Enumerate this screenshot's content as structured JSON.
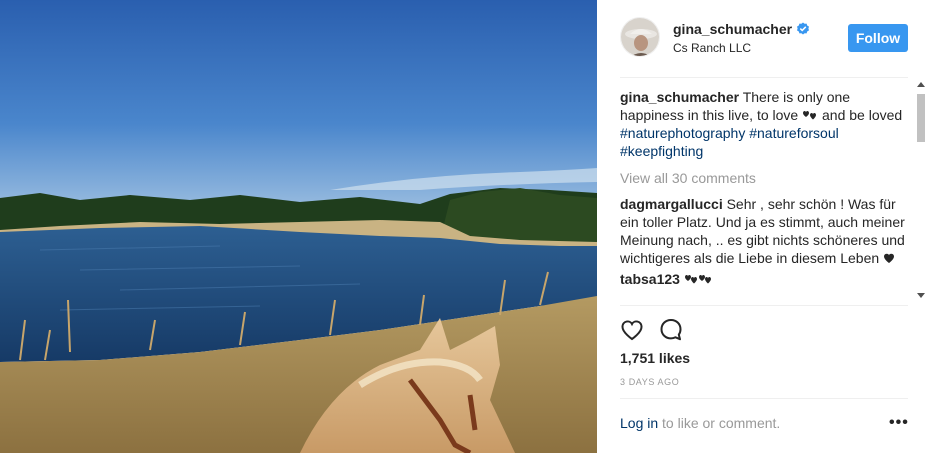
{
  "post": {
    "username": "gina_schumacher",
    "verified_icon": "verified-badge-icon",
    "location": "Cs Ranch LLC",
    "follow_label": "Follow",
    "caption": {
      "user": "gina_schumacher",
      "text_1": "There is only one happiness in this live, to love",
      "text_2": "and be loved",
      "tags": [
        "#naturephotography",
        "#natureforsoul",
        "#keepfighting"
      ]
    },
    "view_all_label": "View all 30 comments",
    "comments": [
      {
        "user": "dagmargallucci",
        "text": "Sehr , sehr schön ! Was für ein toller Platz. Und ja es stimmt, auch meiner Meinung nach, .. es gibt nichts schöneres und wichtigeres als die Liebe in diesem Leben"
      },
      {
        "user": "tabsa123",
        "text": ""
      }
    ],
    "likes": "1,751 likes",
    "date": "3 days ago",
    "login": {
      "link": "Log in",
      "rest": " to like or comment."
    },
    "more_label": "•••"
  },
  "icons": [
    "heart-icon",
    "comment-icon",
    "more-icon"
  ],
  "colors": {
    "follow_button": "#3897f0",
    "hashtag": "#003569",
    "muted": "#999999"
  }
}
